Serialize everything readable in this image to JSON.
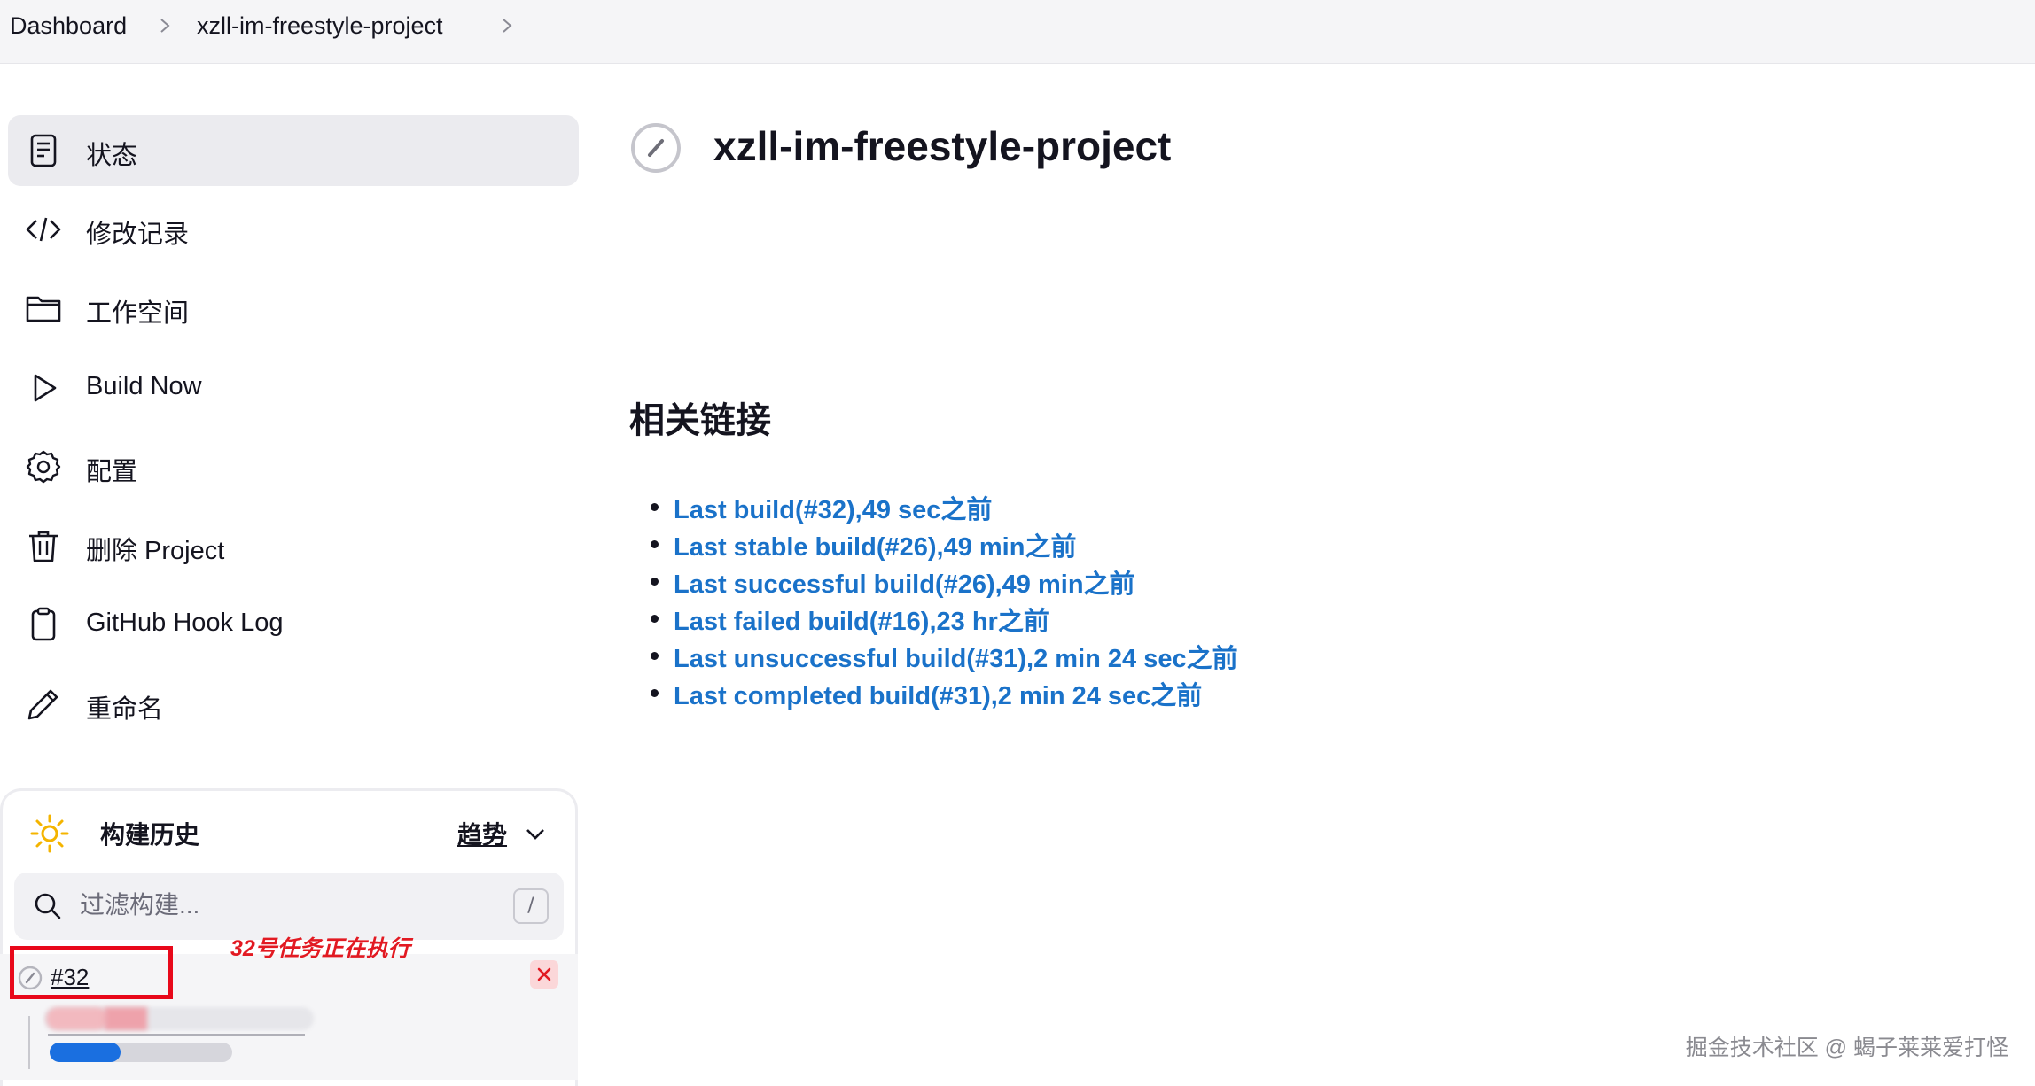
{
  "breadcrumb": {
    "items": [
      "Dashboard",
      "xzll-im-freestyle-project"
    ]
  },
  "sidebar": {
    "items": [
      {
        "label": "状态",
        "icon": "document-icon"
      },
      {
        "label": "修改记录",
        "icon": "code-icon"
      },
      {
        "label": "工作空间",
        "icon": "folder-icon"
      },
      {
        "label": "Build Now",
        "icon": "play-icon"
      },
      {
        "label": "配置",
        "icon": "gear-icon"
      },
      {
        "label": "删除 Project",
        "icon": "trash-icon"
      },
      {
        "label": "GitHub Hook Log",
        "icon": "clipboard-icon"
      },
      {
        "label": "重命名",
        "icon": "pencil-icon"
      }
    ]
  },
  "build_history": {
    "title": "构建历史",
    "trend_label": "趋势",
    "filter_placeholder": "过滤构建...",
    "shortcut_key": "/",
    "builds": [
      {
        "number": "#32",
        "status": "running"
      }
    ],
    "annotation": "32号任务正在执行",
    "progress_fraction": 0.39
  },
  "main": {
    "title": "xzll-im-freestyle-project",
    "section_title": "相关链接",
    "links": [
      "Last build(#32),49 sec之前",
      "Last stable build(#26),49 min之前",
      "Last successful build(#26),49 min之前",
      "Last failed build(#16),23 hr之前",
      "Last unsuccessful build(#31),2 min 24 sec之前",
      "Last completed build(#31),2 min 24 sec之前"
    ]
  },
  "watermark": "掘金技术社区 @ 蝎子莱莱爱打怪",
  "colors": {
    "link": "#1a72c9",
    "annotation": "#e21a22",
    "progress": "#1a6fe0",
    "sun": "#f4b400"
  }
}
